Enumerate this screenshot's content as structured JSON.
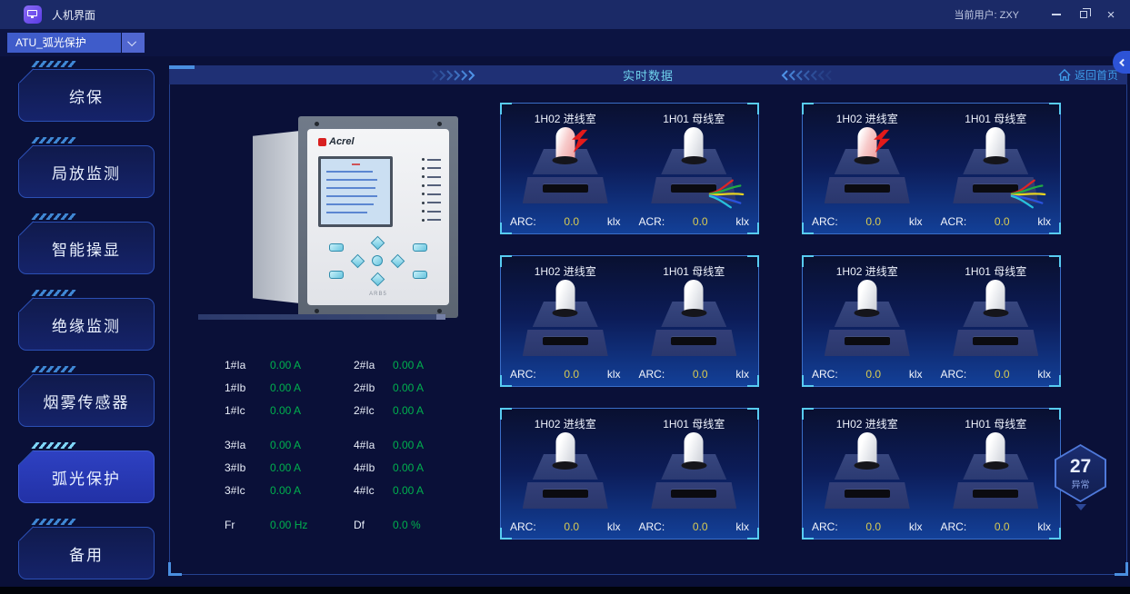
{
  "window": {
    "title": "人机界面",
    "current_user": "当前用户: ZXY",
    "close_glyph": "×"
  },
  "toolbar": {
    "device_selector": {
      "value": "ATU_弧光保护"
    }
  },
  "sidebar": {
    "items": [
      {
        "label": "综保",
        "active": false
      },
      {
        "label": "局放监测",
        "active": false
      },
      {
        "label": "智能操显",
        "active": false
      },
      {
        "label": "绝缘监测",
        "active": false
      },
      {
        "label": "烟雾传感器",
        "active": false
      },
      {
        "label": "弧光保护",
        "active": true
      },
      {
        "label": "备用",
        "active": false
      }
    ]
  },
  "main_header": {
    "title": "实时数据",
    "home_label": "返回首页"
  },
  "device": {
    "brand": "Acrel",
    "model": "ARB5"
  },
  "measurements": {
    "groups": [
      [
        [
          "1#Ia",
          "0.00 A",
          "2#Ia",
          "0.00 A"
        ],
        [
          "1#Ib",
          "0.00 A",
          "2#Ib",
          "0.00 A"
        ],
        [
          "1#Ic",
          "0.00 A",
          "2#Ic",
          "0.00 A"
        ]
      ],
      [
        [
          "3#Ia",
          "0.00 A",
          "4#Ia",
          "0.00 A"
        ],
        [
          "3#Ib",
          "0.00 A",
          "4#Ib",
          "0.00 A"
        ],
        [
          "3#Ic",
          "0.00 A",
          "4#Ic",
          "0.00 A"
        ]
      ],
      [
        [
          "Fr",
          "0.00 Hz",
          "Df",
          "0.0 %"
        ]
      ]
    ]
  },
  "panels": [
    {
      "sensors": [
        {
          "name": "1H02 进线室",
          "label": "ARC:",
          "value": "0.0",
          "unit": "klx",
          "state": "alarm"
        },
        {
          "name": "1H01 母线室",
          "label": "ACR:",
          "value": "0.0",
          "unit": "klx",
          "state": "wires"
        }
      ]
    },
    {
      "sensors": [
        {
          "name": "1H02 进线室",
          "label": "ARC:",
          "value": "0.0",
          "unit": "klx",
          "state": "alarm"
        },
        {
          "name": "1H01 母线室",
          "label": "ACR:",
          "value": "0.0",
          "unit": "klx",
          "state": "wires"
        }
      ]
    },
    {
      "sensors": [
        {
          "name": "1H02 进线室",
          "label": "ARC:",
          "value": "0.0",
          "unit": "klx",
          "state": "normal"
        },
        {
          "name": "1H01 母线室",
          "label": "ARC:",
          "value": "0.0",
          "unit": "klx",
          "state": "normal"
        }
      ]
    },
    {
      "sensors": [
        {
          "name": "1H02 进线室",
          "label": "ARC:",
          "value": "0.0",
          "unit": "klx",
          "state": "normal"
        },
        {
          "name": "1H01 母线室",
          "label": "ARC:",
          "value": "0.0",
          "unit": "klx",
          "state": "normal"
        }
      ]
    },
    {
      "sensors": [
        {
          "name": "1H02 进线室",
          "label": "ARC:",
          "value": "0.0",
          "unit": "klx",
          "state": "normal"
        },
        {
          "name": "1H01 母线室",
          "label": "ARC:",
          "value": "0.0",
          "unit": "klx",
          "state": "normal"
        }
      ]
    },
    {
      "sensors": [
        {
          "name": "1H02 进线室",
          "label": "ARC:",
          "value": "0.0",
          "unit": "klx",
          "state": "normal"
        },
        {
          "name": "1H01 母线室",
          "label": "ARC:",
          "value": "0.0",
          "unit": "klx",
          "state": "normal"
        }
      ]
    }
  ],
  "alarm_badge": {
    "count": "27",
    "label": "异常"
  },
  "colors": {
    "accent_blue": "#3f5cca",
    "value_green": "#00b14e",
    "value_yellow": "#d9cc52",
    "panel_border": "#3a6ec8",
    "alarm_red": "#e31a1a"
  }
}
